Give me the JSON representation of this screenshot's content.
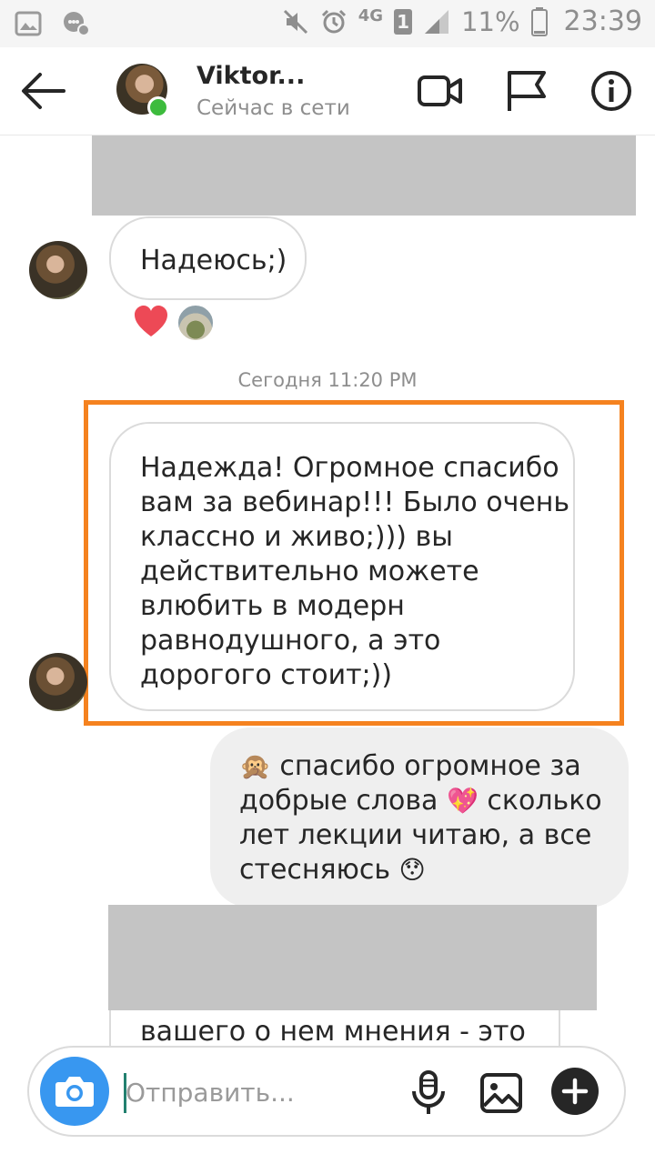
{
  "status_bar": {
    "network": "4G",
    "sim": "1",
    "battery": "11%",
    "time": "23:39"
  },
  "header": {
    "contact_name": "Viktor...",
    "contact_status": "Сейчас в сети",
    "icons": [
      "back-arrow-icon",
      "video-call-icon",
      "flag-icon",
      "info-icon"
    ]
  },
  "messages": [
    {
      "from": "them",
      "text": "Надеюсь;)",
      "reactions": [
        "heart",
        "avatar"
      ]
    },
    {
      "type": "timestamp",
      "text": "Сегодня 11:20 PM"
    },
    {
      "from": "them",
      "highlighted": true,
      "lines": [
        "Надежда! Огромное спасибо",
        "вам за вебинар!!! Было очень",
        "классно и живо;))) вы",
        "действительно можете",
        "влюбить в модерн",
        "равнодушного, а это",
        "дорогого стоит;))"
      ]
    },
    {
      "from": "me",
      "lines": [
        {
          "emoji": "🙊",
          "text": " спасибо огромное за"
        },
        {
          "text": "добрые слова ",
          "emoji_after": "💖",
          "text_after": " сколько"
        },
        {
          "text": "лет лекции читаю, а все"
        },
        {
          "text": "стесняюсь ",
          "emoji_after": "😯"
        }
      ]
    },
    {
      "from": "them",
      "partial_text": "вашего о нем мнения - это"
    }
  ],
  "composer": {
    "placeholder": "Отправить...",
    "value": ""
  },
  "colors": {
    "accent": "#3897f0",
    "online": "#3dbb3d",
    "highlight_box": "#f5821f",
    "bubble_in": "#efefef",
    "redaction": "#c4c4c4"
  }
}
